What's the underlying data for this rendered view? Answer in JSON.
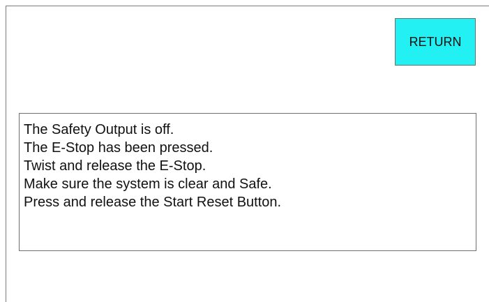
{
  "toolbar": {
    "return_label": "RETURN"
  },
  "message": {
    "lines": [
      "The Safety Output is off.",
      "The E-Stop has been pressed.",
      "Twist and release the E-Stop.",
      "Make sure the system is clear and Safe.",
      "Press and release the Start Reset Button."
    ]
  },
  "colors": {
    "background": "#ffffff",
    "return_button": "#22f0f2",
    "border": "#6f6f6f",
    "text": "#111111"
  }
}
